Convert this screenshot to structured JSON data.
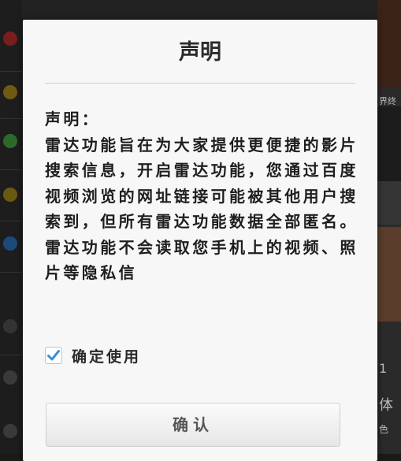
{
  "dialog": {
    "title": "声明",
    "content_heading": "声明：",
    "content_body": "雷达功能旨在为大家提供更便捷的影片搜索信息，开启雷达功能，您通过百度视频浏览的网址链接可能被其他用户搜索到，但所有雷达功能数据全部匿名。雷达功能不会读取您手机上的视频、照片等隐私信",
    "checkbox_label": "确定使用",
    "checkbox_checked": true,
    "confirm_label": "确认"
  },
  "background": {
    "right_texts": [
      "界终",
      "1",
      "体",
      "色"
    ]
  },
  "colors": {
    "dialog_bg": "#f7f7f7",
    "check_accent": "#3d8fd6",
    "text": "#1e1e1e"
  }
}
